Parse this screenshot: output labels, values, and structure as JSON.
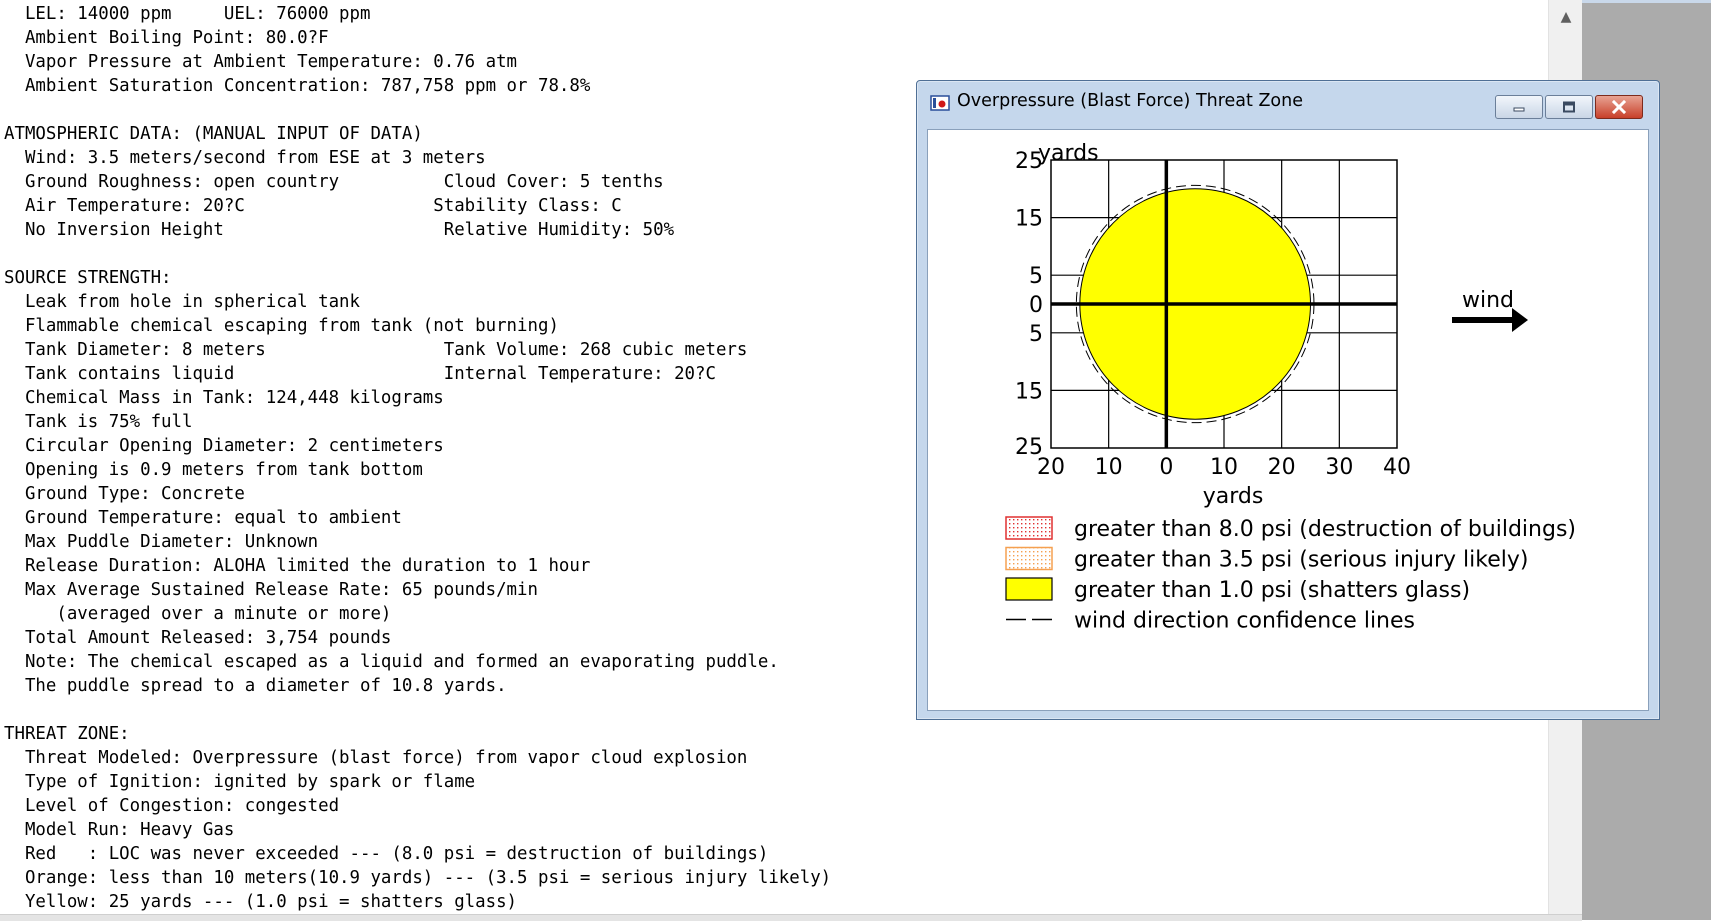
{
  "report": {
    "lines": [
      "  LEL: 14000 ppm     UEL: 76000 ppm",
      "  Ambient Boiling Point: 80.0?F",
      "  Vapor Pressure at Ambient Temperature: 0.76 atm",
      "  Ambient Saturation Concentration: 787,758 ppm or 78.8%",
      "",
      "ATMOSPHERIC DATA: (MANUAL INPUT OF DATA)",
      "  Wind: 3.5 meters/second from ESE at 3 meters",
      "  Ground Roughness: open country          Cloud Cover: 5 tenths",
      "  Air Temperature: 20?C                  Stability Class: C",
      "  No Inversion Height                     Relative Humidity: 50%",
      "",
      "SOURCE STRENGTH:",
      "  Leak from hole in spherical tank",
      "  Flammable chemical escaping from tank (not burning)",
      "  Tank Diameter: 8 meters                 Tank Volume: 268 cubic meters",
      "  Tank contains liquid                    Internal Temperature: 20?C",
      "  Chemical Mass in Tank: 124,448 kilograms",
      "  Tank is 75% full",
      "  Circular Opening Diameter: 2 centimeters",
      "  Opening is 0.9 meters from tank bottom",
      "  Ground Type: Concrete",
      "  Ground Temperature: equal to ambient",
      "  Max Puddle Diameter: Unknown",
      "  Release Duration: ALOHA limited the duration to 1 hour",
      "  Max Average Sustained Release Rate: 65 pounds/min",
      "     (averaged over a minute or more)",
      "  Total Amount Released: 3,754 pounds",
      "  Note: The chemical escaped as a liquid and formed an evaporating puddle.",
      "  The puddle spread to a diameter of 10.8 yards.",
      "",
      "THREAT ZONE:",
      "  Threat Modeled: Overpressure (blast force) from vapor cloud explosion",
      "  Type of Ignition: ignited by spark or flame",
      "  Level of Congestion: congested",
      "  Model Run: Heavy Gas",
      "  Red   : LOC was never exceeded --- (8.0 psi = destruction of buildings)",
      "  Orange: less than 10 meters(10.9 yards) --- (3.5 psi = serious injury likely)",
      "  Yellow: 25 yards --- (1.0 psi = shatters glass)"
    ]
  },
  "scrollbar": {
    "up_icon": "▲"
  },
  "window": {
    "title": "Overpressure (Blast Force) Threat Zone",
    "min_icon": "minimize-icon",
    "max_icon": "maximize-icon",
    "close_icon": "close-icon"
  },
  "wind_label": "wind",
  "legend": [
    {
      "label": "greater than 8.0 psi (destruction of buildings)",
      "color": "#e03030",
      "style": "dotted"
    },
    {
      "label": "greater than 3.5 psi (serious injury likely)",
      "color": "#f5a050",
      "style": "dotted"
    },
    {
      "label": "greater than 1.0 psi (shatters glass)",
      "color": "#ffff00",
      "style": "solid"
    },
    {
      "label": "wind direction confidence lines",
      "color": "#000000",
      "style": "dashed"
    }
  ],
  "chart_data": {
    "type": "scatter",
    "xlabel": "yards",
    "ylabel": "yards",
    "x_ticks": [
      "20",
      "10",
      "0",
      "10",
      "20",
      "30",
      "40"
    ],
    "y_ticks": [
      "25",
      "15",
      "5",
      "0",
      "5",
      "15",
      "25"
    ],
    "xlim": [
      -20,
      40
    ],
    "ylim": [
      -25,
      25
    ],
    "grid": true,
    "zones": [
      {
        "name": "greater than 1.0 psi (shatters glass)",
        "center": [
          5,
          0
        ],
        "radius": 20,
        "color": "#ffff00"
      }
    ],
    "confidence_line_radius": 20.6
  }
}
